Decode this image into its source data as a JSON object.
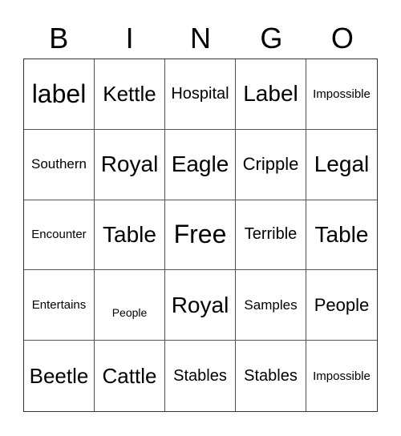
{
  "header": [
    "B",
    "I",
    "N",
    "G",
    "O"
  ],
  "cells": [
    "label",
    "Kettle",
    "Hospital",
    "Label",
    "Impossible",
    "Southern",
    "Royal",
    "Eagle",
    "Cripple",
    "Legal",
    "Encounter",
    "Table",
    "Free",
    "Terrible",
    "Table",
    "Entertains",
    "People",
    "Royal",
    "Samples",
    "People",
    "Beetle",
    "Cattle",
    "Stables",
    "Stables",
    "Impossible"
  ]
}
